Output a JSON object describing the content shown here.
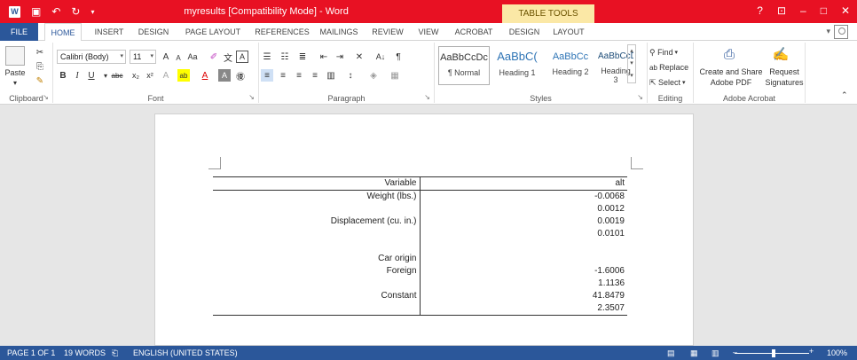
{
  "titlebar": {
    "app_icon": "W",
    "document_title": "myresults [Compatibility Mode] - Word",
    "contextual_label": "TABLE TOOLS",
    "save_icon": "save-icon",
    "undo_icon": "undo-icon",
    "redo_icon": "redo-icon",
    "help_glyph": "?",
    "minimize_glyph": "–",
    "restore_glyph": "□",
    "close_glyph": "✕"
  },
  "tabs": [
    "FILE",
    "HOME",
    "INSERT",
    "DESIGN",
    "PAGE LAYOUT",
    "REFERENCES",
    "MAILINGS",
    "REVIEW",
    "VIEW",
    "ACROBAT",
    "DESIGN",
    "LAYOUT"
  ],
  "ribbon": {
    "clipboard": {
      "paste_label": "Paste",
      "group_label": "Clipboard"
    },
    "font": {
      "font_name": "Calibri (Body)",
      "font_size": "11",
      "group_label": "Font"
    },
    "paragraph": {
      "group_label": "Paragraph"
    },
    "styles": {
      "items": [
        {
          "sample": "AaBbCcDc",
          "name": "¶ Normal"
        },
        {
          "sample": "AaBbC(",
          "name": "Heading 1"
        },
        {
          "sample": "AaBbCc",
          "name": "Heading 2"
        },
        {
          "sample": "AaBbCcD",
          "name": "Heading 3"
        }
      ],
      "group_label": "Styles"
    },
    "editing": {
      "find": "Find",
      "replace": "Replace",
      "select": "Select",
      "group_label": "Editing"
    },
    "acrobat": {
      "create_share": "Create and Share",
      "adobe_pdf": "Adobe PDF",
      "request": "Request",
      "signatures": "Signatures",
      "group_label": "Adobe Acrobat"
    }
  },
  "table": {
    "header": [
      "Variable",
      "alt"
    ],
    "rows": [
      [
        "Weight (lbs.)",
        "-0.0068"
      ],
      [
        "",
        "0.0012"
      ],
      [
        "Displacement (cu. in.)",
        "0.0019"
      ],
      [
        "",
        "0.0101"
      ],
      [
        "",
        ""
      ],
      [
        "Car origin",
        ""
      ],
      [
        "Foreign",
        "-1.6006"
      ],
      [
        "",
        "1.1136"
      ],
      [
        "Constant",
        "41.8479"
      ],
      [
        "",
        "2.3507"
      ]
    ]
  },
  "statusbar": {
    "page": "PAGE 1 OF 1",
    "words": "19 WORDS",
    "language": "ENGLISH (UNITED STATES)",
    "zoom": "100%",
    "zoom_percent": 100
  },
  "colors": {
    "title_bar": "#e81123",
    "accent": "#2b579a",
    "contextual_tab": "#fbe8a6"
  }
}
